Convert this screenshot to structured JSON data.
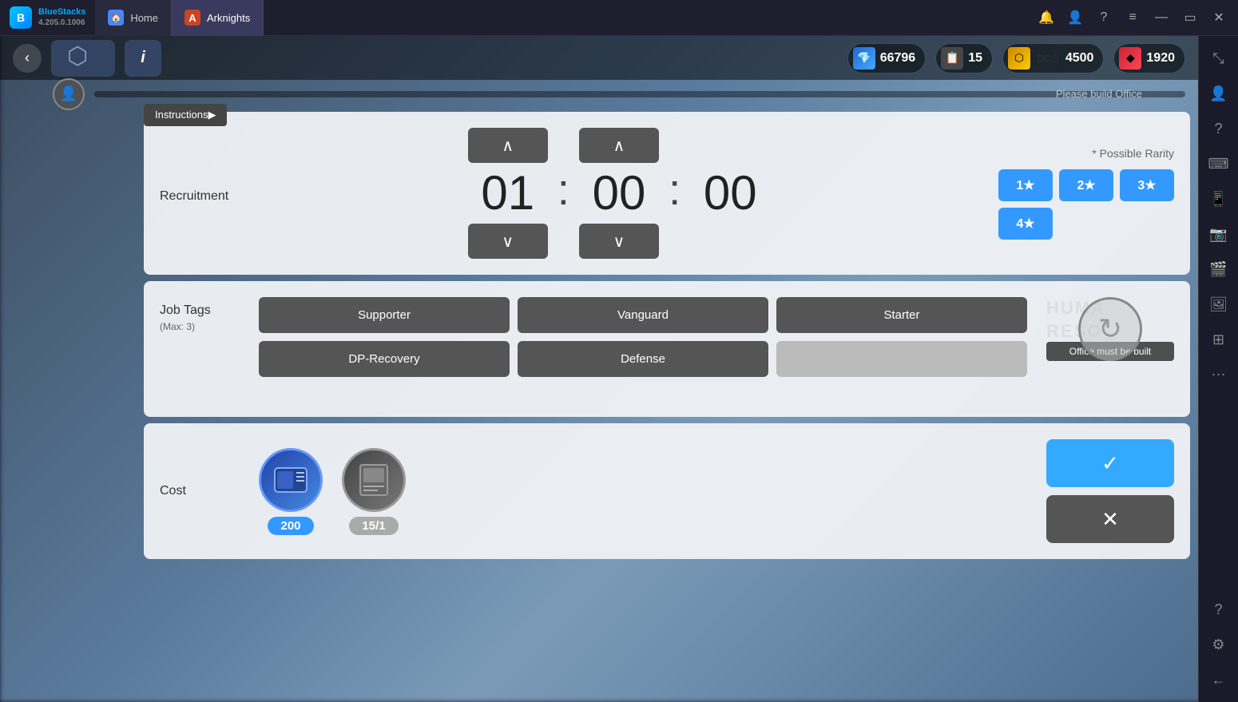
{
  "titlebar": {
    "app_name": "BlueStacks",
    "app_version": "4.205.0.1006",
    "tabs": [
      {
        "id": "home",
        "label": "Home",
        "icon": "🏠",
        "active": false
      },
      {
        "id": "arknights",
        "label": "Arknights",
        "icon": "A",
        "active": true
      }
    ],
    "window_controls": [
      "minimize",
      "maximize",
      "close"
    ]
  },
  "sidebar": {
    "buttons": [
      {
        "id": "expand",
        "icon": "⤡"
      },
      {
        "id": "account",
        "icon": "👤"
      },
      {
        "id": "help",
        "icon": "?"
      },
      {
        "id": "menu",
        "icon": "≡"
      },
      {
        "id": "minimize-win",
        "icon": "—"
      },
      {
        "id": "restore",
        "icon": "▭"
      },
      {
        "id": "close-win",
        "icon": "✕"
      },
      {
        "id": "expand2",
        "icon": "⤡"
      }
    ],
    "right_tools": [
      {
        "id": "notification",
        "icon": "🔔"
      },
      {
        "id": "profile",
        "icon": "👤"
      },
      {
        "id": "question",
        "icon": "?"
      },
      {
        "id": "keyboard",
        "icon": "⌨"
      },
      {
        "id": "mobile",
        "icon": "📱"
      },
      {
        "id": "camera",
        "icon": "📷"
      },
      {
        "id": "video",
        "icon": "🎬"
      },
      {
        "id": "gallery",
        "icon": "🖼"
      },
      {
        "id": "layers",
        "icon": "⊞"
      },
      {
        "id": "more",
        "icon": "⋯"
      },
      {
        "id": "question2",
        "icon": "?"
      },
      {
        "id": "settings",
        "icon": "⚙"
      },
      {
        "id": "back",
        "icon": "←"
      }
    ]
  },
  "game_topbar": {
    "back_label": "‹",
    "info_label": "i",
    "resources": {
      "sanity": {
        "value": "66796",
        "icon": "💎"
      },
      "recruit": {
        "value": "15",
        "icon": "📋"
      },
      "orundum": {
        "value": "4500",
        "icon": "⬡"
      },
      "gem": {
        "value": "1920",
        "icon": "◆"
      }
    },
    "progress_bar_text": "Please build Office",
    "progress_bar_fill": 0
  },
  "instructions_btn": {
    "label": "Instructions▶"
  },
  "recruitment": {
    "label": "Recruitment",
    "timer": {
      "hours": "01",
      "minutes": "00",
      "seconds": "00"
    },
    "rarity_title": "* Possible Rarity",
    "rarity_options": [
      {
        "id": "1star",
        "label": "1★",
        "active": true
      },
      {
        "id": "2star",
        "label": "2★",
        "active": true
      },
      {
        "id": "3star",
        "label": "3★",
        "active": true
      },
      {
        "id": "4star",
        "label": "4★",
        "active": true
      }
    ]
  },
  "job_tags": {
    "label": "Job Tags",
    "sublabel": "(Max: 3)",
    "tags": [
      {
        "id": "supporter",
        "label": "Supporter",
        "active": true
      },
      {
        "id": "vanguard",
        "label": "Vanguard",
        "active": true
      },
      {
        "id": "starter",
        "label": "Starter",
        "active": true
      },
      {
        "id": "dp-recovery",
        "label": "DP-Recovery",
        "active": true
      },
      {
        "id": "defense",
        "label": "Defense",
        "active": true
      },
      {
        "id": "empty",
        "label": "",
        "active": false
      }
    ],
    "office_must_built_text": "Office must be built",
    "hr_bg_text": "HUMA\nRESO"
  },
  "cost": {
    "label": "Cost",
    "items": [
      {
        "id": "recruitment-ticket",
        "icon": "🎫",
        "value": "200",
        "color": "blue"
      },
      {
        "id": "expedited-plan",
        "icon": "📦",
        "value": "15/1",
        "color": "gray"
      }
    ],
    "confirm_icon": "✓",
    "cancel_icon": "✕"
  }
}
